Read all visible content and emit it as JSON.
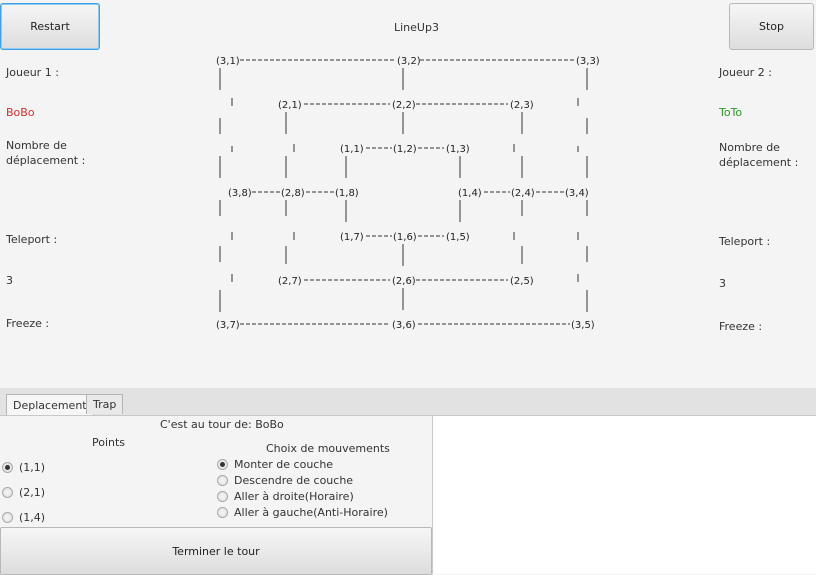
{
  "window": {
    "title": "LineUp3"
  },
  "toolbar": {
    "restart_label": "Restart",
    "stop_label": "Stop"
  },
  "player1": {
    "header": "Joueur 1 :",
    "name": "BoBo",
    "moves_label_line1": "Nombre de",
    "moves_label_line2": "déplacement :",
    "teleport_label": "Teleport :",
    "teleport_value": "3",
    "freeze_label": "Freeze :",
    "color": "#d62d2d"
  },
  "player2": {
    "header": "Joueur 2 :",
    "name": "ToTo",
    "moves_label_line1": "Nombre de",
    "moves_label_line2": "déplacement :",
    "teleport_label": "Teleport :",
    "teleport_value": "3",
    "freeze_label": "Freeze :",
    "color": "#2a9a2a"
  },
  "board": {
    "nodes": [
      {
        "id": "n31",
        "label": "(3,1)",
        "owner": "none"
      },
      {
        "id": "n32",
        "label": "(3,2)",
        "owner": "p2"
      },
      {
        "id": "n33",
        "label": "(3,3)",
        "owner": "none"
      },
      {
        "id": "n21",
        "label": "(2,1)",
        "owner": "p1"
      },
      {
        "id": "n22",
        "label": "(2,2)",
        "owner": "none"
      },
      {
        "id": "n23",
        "label": "(2,3)",
        "owner": "none"
      },
      {
        "id": "n11",
        "label": "(1,1)",
        "owner": "p1"
      },
      {
        "id": "n12",
        "label": "(1,2)",
        "owner": "p2"
      },
      {
        "id": "n13",
        "label": "(1,3)",
        "owner": "none"
      },
      {
        "id": "n38",
        "label": "(3,8)",
        "owner": "none"
      },
      {
        "id": "n28",
        "label": "(2,8)",
        "owner": "none"
      },
      {
        "id": "n18",
        "label": "(1,8)",
        "owner": "none"
      },
      {
        "id": "n14",
        "label": "(1,4)",
        "owner": "p1"
      },
      {
        "id": "n24",
        "label": "(2,4)",
        "owner": "p2"
      },
      {
        "id": "n34",
        "label": "(3,4)",
        "owner": "none"
      },
      {
        "id": "n17",
        "label": "(1,7)",
        "owner": "none"
      },
      {
        "id": "n16",
        "label": "(1,6)",
        "owner": "none"
      },
      {
        "id": "n15",
        "label": "(1,5)",
        "owner": "none"
      },
      {
        "id": "n27",
        "label": "(2,7)",
        "owner": "none"
      },
      {
        "id": "n26",
        "label": "(2,6)",
        "owner": "none"
      },
      {
        "id": "n25",
        "label": "(2,5)",
        "owner": "none"
      },
      {
        "id": "n37",
        "label": "(3,7)",
        "owner": "none"
      },
      {
        "id": "n36",
        "label": "(3,6)",
        "owner": "none"
      },
      {
        "id": "n35",
        "label": "(3,5)",
        "owner": "none"
      }
    ]
  },
  "tabs": [
    {
      "label": "Deplacement",
      "active": true
    },
    {
      "label": "Trap",
      "active": false
    }
  ],
  "turn": {
    "text": "C'est au tour de: BoBo"
  },
  "points": {
    "header": "Points",
    "options": [
      {
        "label": "(1,1)",
        "selected": true
      },
      {
        "label": "(2,1)",
        "selected": false
      },
      {
        "label": "(1,4)",
        "selected": false
      }
    ]
  },
  "moves": {
    "header": "Choix de mouvements",
    "options": [
      {
        "label": "Monter de couche",
        "selected": true
      },
      {
        "label": "Descendre de couche",
        "selected": false
      },
      {
        "label": "Aller à droite(Horaire)",
        "selected": false
      },
      {
        "label": "Aller à gauche(Anti-Horaire)",
        "selected": false
      }
    ]
  },
  "end_turn": {
    "label": "Terminer le tour"
  }
}
